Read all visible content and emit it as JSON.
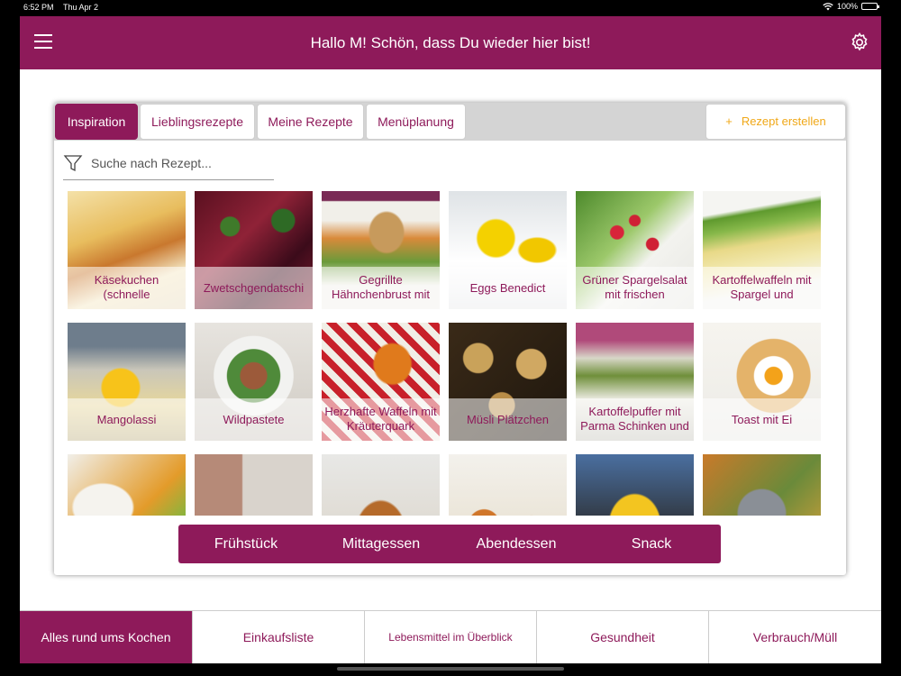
{
  "status": {
    "time": "6:52 PM",
    "date": "Thu Apr 2",
    "battery": "100%"
  },
  "header": {
    "title": "Hallo M! Schön, dass Du wieder hier bist!"
  },
  "tabs": [
    {
      "label": "Inspiration",
      "active": true
    },
    {
      "label": "Lieblingsrezepte",
      "active": false
    },
    {
      "label": "Meine Rezepte",
      "active": false
    },
    {
      "label": "Menüplanung",
      "active": false
    }
  ],
  "create_button": {
    "icon": "+",
    "label": "Rezept erstellen"
  },
  "search": {
    "placeholder": "Suche nach Rezept..."
  },
  "recipes": [
    {
      "label": "Käsekuchen (schnelle"
    },
    {
      "label": "Zwetschgendatschi"
    },
    {
      "label": "Gegrillte Hähnchenbrust mit"
    },
    {
      "label": "Eggs Benedict"
    },
    {
      "label": "Grüner Spargelsalat mit frischen"
    },
    {
      "label": "Kartoffelwaffeln mit Spargel und"
    },
    {
      "label": "Mangolassi"
    },
    {
      "label": "Wildpastete"
    },
    {
      "label": "Herzhafte Waffeln mit Kräuterquark"
    },
    {
      "label": "Müsli Plätzchen"
    },
    {
      "label": "Kartoffelpuffer mit Parma Schinken und"
    },
    {
      "label": "Toast mit Ei"
    },
    {
      "label": ""
    },
    {
      "label": ""
    },
    {
      "label": ""
    },
    {
      "label": ""
    },
    {
      "label": ""
    },
    {
      "label": ""
    }
  ],
  "meals": [
    "Frühstück",
    "Mittagessen",
    "Abendessen",
    "Snack"
  ],
  "bottom_nav": [
    {
      "label": "Alles rund ums Kochen",
      "active": true
    },
    {
      "label": "Einkaufsliste",
      "active": false
    },
    {
      "label": "Lebensmittel im Überblick",
      "active": false
    },
    {
      "label": "Gesundheit",
      "active": false
    },
    {
      "label": "Verbrauch/Müll",
      "active": false
    }
  ],
  "colors": {
    "brand": "#8e1a5a",
    "accent": "#f0a818",
    "tabbar": "#d4d4d4"
  }
}
